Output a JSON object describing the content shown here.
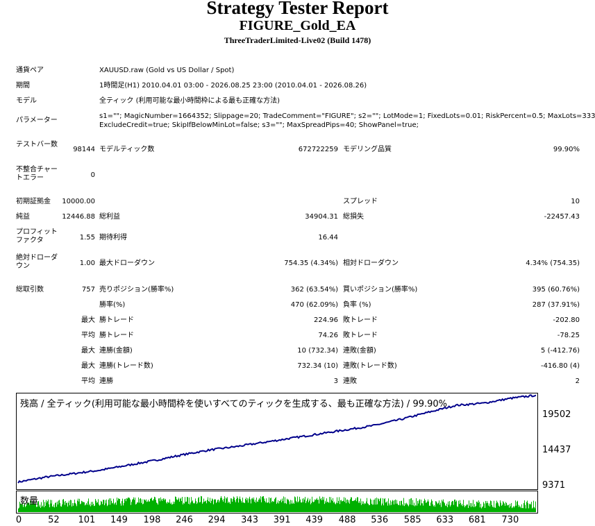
{
  "report": {
    "title": "Strategy Tester Report",
    "ea_name": "FIGURE_Gold_EA",
    "server": "ThreeTraderLimited-Live02 (Build 1478)"
  },
  "info": {
    "symbol_label": "通貨ペア",
    "symbol_value": "XAUUSD.raw (Gold vs US Dollar / Spot)",
    "period_label": "期間",
    "period_value": "1時間足(H1) 2010.04.01 03:00 - 2026.08.25 23:00 (2010.04.01 - 2026.08.26)",
    "model_label": "モデル",
    "model_value": "全ティック (利用可能な最小時間枠による最も正確な方法)",
    "params_label": "パラメーター",
    "params_line1": "s1=\"\"; MagicNumber=1664352; Slippage=20; TradeComment=\"FIGURE\"; s2=\"\"; LotMode=1; FixedLots=0.01; RiskPercent=0.5; MaxLots=33333;",
    "params_line2": "ExcludeCredit=true; SkipIfBelowMinLot=false; s3=\"\"; MaxSpreadPips=40; ShowPanel=true;"
  },
  "stats": {
    "bars_label": "テストバー数",
    "bars_value": "98144",
    "ticks_label": "モデルティック数",
    "ticks_value": "672722259",
    "quality_label": "モデリング品質",
    "quality_value": "99.90%",
    "mismatch_label": "不整合チャートエラー",
    "mismatch_value": "0",
    "deposit_label": "初期証拠金",
    "deposit_value": "10000.00",
    "spread_label": "スプレッド",
    "spread_value": "10",
    "net_label": "純益",
    "net_value": "12446.88",
    "gross_profit_label": "総利益",
    "gross_profit_value": "34904.31",
    "gross_loss_label": "総損失",
    "gross_loss_value": "-22457.43",
    "pf_label": "プロフィットファクタ",
    "pf_value": "1.55",
    "expected_label": "期待利得",
    "expected_value": "16.44",
    "abs_dd_label": "絶対ドローダウン",
    "abs_dd_value": "1.00",
    "max_dd_label": "最大ドローダウン",
    "max_dd_value": "754.35 (4.34%)",
    "rel_dd_label": "相対ドローダウン",
    "rel_dd_value": "4.34% (754.35)",
    "trades_label": "総取引数",
    "trades_value": "757",
    "short_label": "売りポジション(勝率%)",
    "short_value": "362 (63.54%)",
    "long_label": "買いポジション(勝率%)",
    "long_value": "395 (60.76%)",
    "win_rate_label": "勝率(%)",
    "win_rate_value": "470 (62.09%)",
    "loss_rate_label": "負率 (%)",
    "loss_rate_value": "287 (37.91%)",
    "max_label": "最大",
    "avg_label": "平均",
    "largest_win_label": "勝トレード",
    "largest_win_value": "224.96",
    "largest_loss_label": "敗トレード",
    "largest_loss_value": "-202.80",
    "avg_win_label": "勝トレード",
    "avg_win_value": "74.26",
    "avg_loss_label": "敗トレード",
    "avg_loss_value": "-78.25",
    "consec_win_amt_label": "連勝(金額)",
    "consec_win_amt_value": "10 (732.34)",
    "consec_loss_amt_label": "連敗(金額)",
    "consec_loss_amt_value": "5 (-412.76)",
    "consec_win_cnt_label": "連勝(トレード数)",
    "consec_win_cnt_value": "732.34 (10)",
    "consec_loss_cnt_label": "連敗(トレード数)",
    "consec_loss_cnt_value": "-416.80 (4)",
    "avg_consec_win_label": "連勝",
    "avg_consec_win_value": "3",
    "avg_consec_loss_label": "連敗",
    "avg_consec_loss_value": "2"
  },
  "chart_data": {
    "type": "line",
    "title": "残高 / 全ティック(利用可能な最小時間枠を使いすべてのティックを生成する、最も正確な方法) / 99.90%",
    "y_ticks": [
      "19502",
      "14437",
      "9371"
    ],
    "y_tick_values": [
      19502,
      14437,
      9371
    ],
    "x_ticks": [
      "0",
      "52",
      "101",
      "149",
      "198",
      "246",
      "294",
      "343",
      "391",
      "439",
      "488",
      "536",
      "585",
      "633",
      "681",
      "730"
    ],
    "x_tick_values": [
      0,
      52,
      101,
      149,
      198,
      246,
      294,
      343,
      391,
      439,
      488,
      536,
      585,
      633,
      681,
      730
    ],
    "xlim": [
      0,
      757
    ],
    "ylim": [
      9371,
      22300
    ],
    "line_color": "#00008b",
    "series": [
      {
        "x": [
          0,
          40,
          80,
          120,
          160,
          200,
          240,
          280,
          320,
          360,
          400,
          440,
          480,
          520,
          560,
          600,
          640,
          680,
          720,
          757
        ],
        "y": [
          10000,
          10700,
          11200,
          11700,
          12400,
          13100,
          13900,
          14600,
          15100,
          15700,
          16300,
          16900,
          17500,
          18100,
          19000,
          20000,
          21000,
          21300,
          22000,
          22447
        ]
      }
    ],
    "volume_label": "数量",
    "volume_color": "#00b000"
  }
}
